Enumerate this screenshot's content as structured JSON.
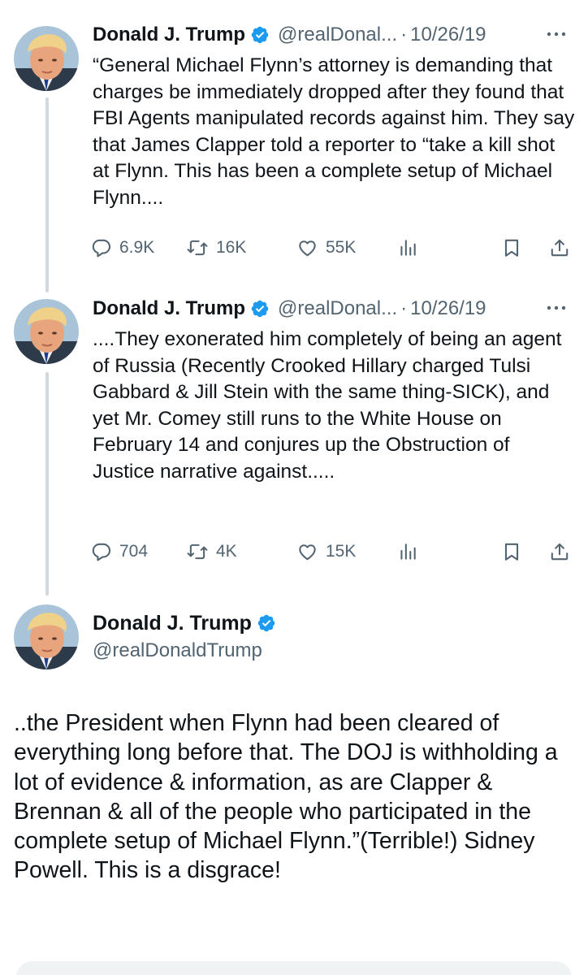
{
  "colors": {
    "text": "#0f1419",
    "secondary": "#536471",
    "verified": "#1d9bf0",
    "thread_line": "#cfd9de"
  },
  "tweets": [
    {
      "author": "Donald J. Trump",
      "handle": "@realDonal...",
      "separator": "·",
      "date": "10/26/19",
      "text": "“General Michael Flynn’s attorney is demanding that charges be immediately dropped after they found that FBI Agents manipulated records against him. They say that James Clapper told a reporter to “take a kill shot at Flynn. This has been a complete setup of Michael Flynn....",
      "replies": "6.9K",
      "retweets": "16K",
      "likes": "55K"
    },
    {
      "author": "Donald J. Trump",
      "handle": "@realDonal...",
      "separator": "·",
      "date": "10/26/19",
      "text": "....They exonerated him completely of being an agent of Russia (Recently Crooked Hillary charged Tulsi Gabbard & Jill Stein with the same thing-SICK), and yet Mr. Comey still runs to the White House on February 14 and conjures up the Obstruction of Justice narrative against.....",
      "replies": "704",
      "retweets": "4K",
      "likes": "15K"
    }
  ],
  "main_tweet": {
    "author": "Donald J. Trump",
    "handle": "@realDonaldTrump",
    "text": "..the President when Flynn had been cleared of everything long before that. The DOJ is withholding a lot of evidence & information, as are Clapper & Brennan & all of the people who participated in the complete setup of Michael Flynn.”(Terrible!) Sidney Powell. This is a disgrace!"
  },
  "icons": {
    "verified": "verified-badge-icon",
    "more": "more-icon",
    "reply": "reply-icon",
    "retweet": "retweet-icon",
    "like": "heart-icon",
    "views": "views-icon",
    "bookmark": "bookmark-icon",
    "share": "share-icon"
  }
}
